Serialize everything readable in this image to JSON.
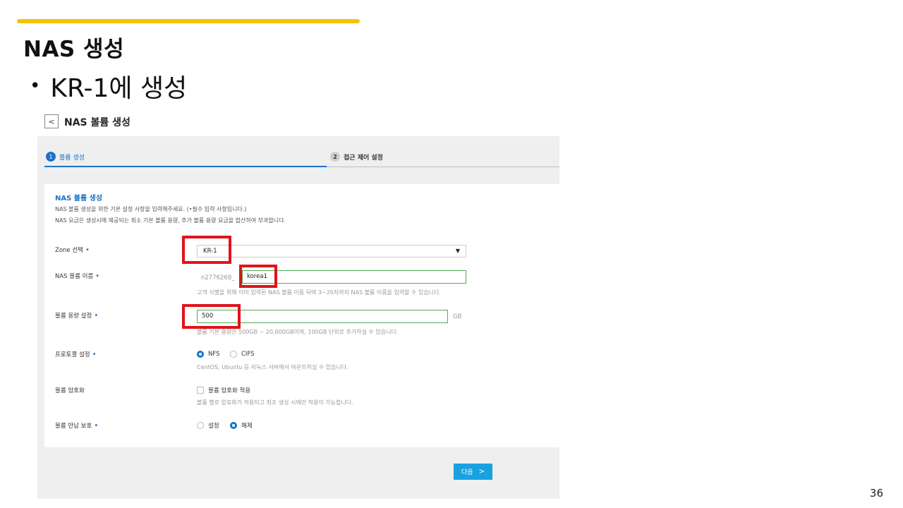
{
  "slide": {
    "title": "NAS 생성",
    "bullet": "KR-1에 생성",
    "page_number": "36"
  },
  "ui": {
    "back_icon": "chevron-left-icon",
    "title": "NAS 볼륨 생성",
    "steps": [
      {
        "num": "1",
        "label": "볼륨 생성",
        "active": true
      },
      {
        "num": "2",
        "label": "접근 제어 설정",
        "active": false
      }
    ],
    "card": {
      "title": "NAS 볼륨 생성",
      "desc1": "NAS 볼륨 생성을 위한 기본 설정 사항을 입력해주세요. (•필수 입력 사항입니다.)",
      "desc2": "NAS 요금은 생성시에 제공되는 최소 기본 볼륨 용량, 추가 볼륨 용량 요금을 합산하여 부과합니다."
    },
    "required_mark": "•",
    "zone": {
      "label": "Zone 선택",
      "value": "KR-1"
    },
    "volume_name": {
      "label": "NAS 볼륨 이름",
      "prefix": "n2776268_",
      "value": "korea1",
      "help": "고객 식별을 위해 이미 입력된 NAS 볼륨 이름 뒤에 3~20자까지 NAS 볼륨 이름을 입력할 수 있습니다."
    },
    "volume_size": {
      "label": "볼륨 용량 설정",
      "value": "500",
      "unit": "GB",
      "help": "볼륨 기본 용량은 500GB ~ 20,000GB이며, 100GB 단위로 추가하실 수 있습니다."
    },
    "protocol": {
      "label": "프로토콜 설정",
      "options": [
        "NFS",
        "CIFS"
      ],
      "selected": "NFS",
      "help": "CentOS, Ubuntu 등 리눅스 서버에서 마운트하실 수 있습니다."
    },
    "encryption": {
      "label": "볼륨 암호화",
      "checkbox_label": "볼륨 암호화 적용",
      "checked": false,
      "help": "볼륨 별로 암호화가 적용되고 최초 생성 시에만 적용이 가능합니다."
    },
    "return_protection": {
      "label": "볼륨 반납 보호",
      "options": [
        "설정",
        "해제"
      ],
      "selected": "해제"
    },
    "next_button": "다음",
    "accent_color": "#1a73c8",
    "highlight_color": "#e0141b",
    "slide_accent_color": "#f5c400"
  }
}
